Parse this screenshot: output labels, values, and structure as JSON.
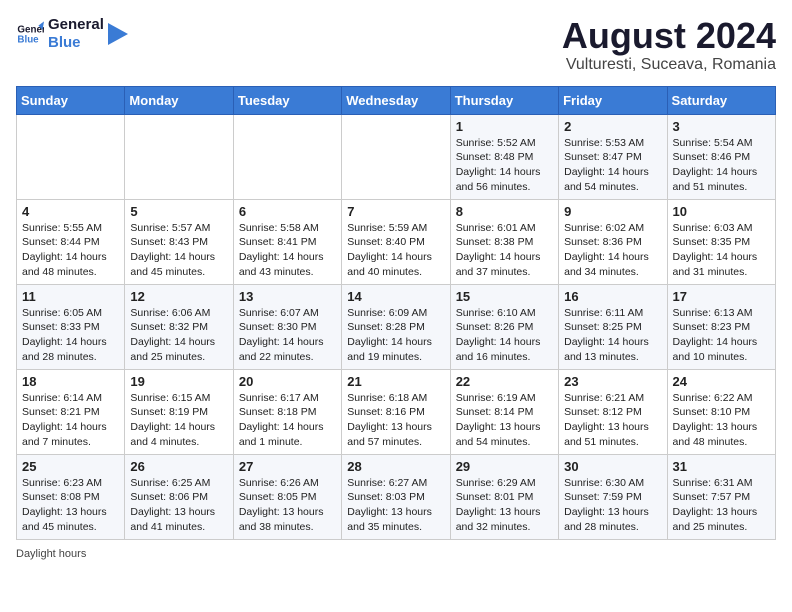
{
  "header": {
    "logo_line1": "General",
    "logo_line2": "Blue",
    "month_year": "August 2024",
    "location": "Vulturesti, Suceava, Romania"
  },
  "days_of_week": [
    "Sunday",
    "Monday",
    "Tuesday",
    "Wednesday",
    "Thursday",
    "Friday",
    "Saturday"
  ],
  "weeks": [
    [
      {
        "day": "",
        "text": ""
      },
      {
        "day": "",
        "text": ""
      },
      {
        "day": "",
        "text": ""
      },
      {
        "day": "",
        "text": ""
      },
      {
        "day": "1",
        "text": "Sunrise: 5:52 AM\nSunset: 8:48 PM\nDaylight: 14 hours and 56 minutes."
      },
      {
        "day": "2",
        "text": "Sunrise: 5:53 AM\nSunset: 8:47 PM\nDaylight: 14 hours and 54 minutes."
      },
      {
        "day": "3",
        "text": "Sunrise: 5:54 AM\nSunset: 8:46 PM\nDaylight: 14 hours and 51 minutes."
      }
    ],
    [
      {
        "day": "4",
        "text": "Sunrise: 5:55 AM\nSunset: 8:44 PM\nDaylight: 14 hours and 48 minutes."
      },
      {
        "day": "5",
        "text": "Sunrise: 5:57 AM\nSunset: 8:43 PM\nDaylight: 14 hours and 45 minutes."
      },
      {
        "day": "6",
        "text": "Sunrise: 5:58 AM\nSunset: 8:41 PM\nDaylight: 14 hours and 43 minutes."
      },
      {
        "day": "7",
        "text": "Sunrise: 5:59 AM\nSunset: 8:40 PM\nDaylight: 14 hours and 40 minutes."
      },
      {
        "day": "8",
        "text": "Sunrise: 6:01 AM\nSunset: 8:38 PM\nDaylight: 14 hours and 37 minutes."
      },
      {
        "day": "9",
        "text": "Sunrise: 6:02 AM\nSunset: 8:36 PM\nDaylight: 14 hours and 34 minutes."
      },
      {
        "day": "10",
        "text": "Sunrise: 6:03 AM\nSunset: 8:35 PM\nDaylight: 14 hours and 31 minutes."
      }
    ],
    [
      {
        "day": "11",
        "text": "Sunrise: 6:05 AM\nSunset: 8:33 PM\nDaylight: 14 hours and 28 minutes."
      },
      {
        "day": "12",
        "text": "Sunrise: 6:06 AM\nSunset: 8:32 PM\nDaylight: 14 hours and 25 minutes."
      },
      {
        "day": "13",
        "text": "Sunrise: 6:07 AM\nSunset: 8:30 PM\nDaylight: 14 hours and 22 minutes."
      },
      {
        "day": "14",
        "text": "Sunrise: 6:09 AM\nSunset: 8:28 PM\nDaylight: 14 hours and 19 minutes."
      },
      {
        "day": "15",
        "text": "Sunrise: 6:10 AM\nSunset: 8:26 PM\nDaylight: 14 hours and 16 minutes."
      },
      {
        "day": "16",
        "text": "Sunrise: 6:11 AM\nSunset: 8:25 PM\nDaylight: 14 hours and 13 minutes."
      },
      {
        "day": "17",
        "text": "Sunrise: 6:13 AM\nSunset: 8:23 PM\nDaylight: 14 hours and 10 minutes."
      }
    ],
    [
      {
        "day": "18",
        "text": "Sunrise: 6:14 AM\nSunset: 8:21 PM\nDaylight: 14 hours and 7 minutes."
      },
      {
        "day": "19",
        "text": "Sunrise: 6:15 AM\nSunset: 8:19 PM\nDaylight: 14 hours and 4 minutes."
      },
      {
        "day": "20",
        "text": "Sunrise: 6:17 AM\nSunset: 8:18 PM\nDaylight: 14 hours and 1 minute."
      },
      {
        "day": "21",
        "text": "Sunrise: 6:18 AM\nSunset: 8:16 PM\nDaylight: 13 hours and 57 minutes."
      },
      {
        "day": "22",
        "text": "Sunrise: 6:19 AM\nSunset: 8:14 PM\nDaylight: 13 hours and 54 minutes."
      },
      {
        "day": "23",
        "text": "Sunrise: 6:21 AM\nSunset: 8:12 PM\nDaylight: 13 hours and 51 minutes."
      },
      {
        "day": "24",
        "text": "Sunrise: 6:22 AM\nSunset: 8:10 PM\nDaylight: 13 hours and 48 minutes."
      }
    ],
    [
      {
        "day": "25",
        "text": "Sunrise: 6:23 AM\nSunset: 8:08 PM\nDaylight: 13 hours and 45 minutes."
      },
      {
        "day": "26",
        "text": "Sunrise: 6:25 AM\nSunset: 8:06 PM\nDaylight: 13 hours and 41 minutes."
      },
      {
        "day": "27",
        "text": "Sunrise: 6:26 AM\nSunset: 8:05 PM\nDaylight: 13 hours and 38 minutes."
      },
      {
        "day": "28",
        "text": "Sunrise: 6:27 AM\nSunset: 8:03 PM\nDaylight: 13 hours and 35 minutes."
      },
      {
        "day": "29",
        "text": "Sunrise: 6:29 AM\nSunset: 8:01 PM\nDaylight: 13 hours and 32 minutes."
      },
      {
        "day": "30",
        "text": "Sunrise: 6:30 AM\nSunset: 7:59 PM\nDaylight: 13 hours and 28 minutes."
      },
      {
        "day": "31",
        "text": "Sunrise: 6:31 AM\nSunset: 7:57 PM\nDaylight: 13 hours and 25 minutes."
      }
    ]
  ],
  "footer": {
    "daylight_label": "Daylight hours"
  }
}
